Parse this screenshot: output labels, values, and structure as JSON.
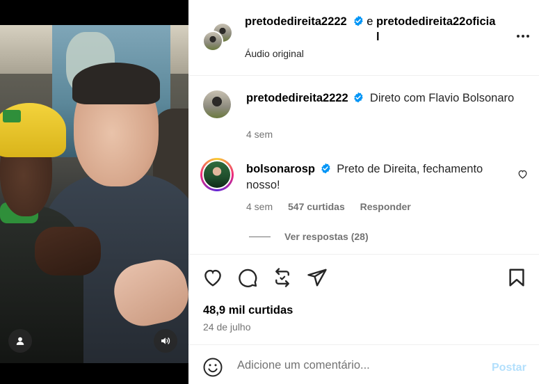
{
  "header": {
    "user1": "pretodedireita2222",
    "conjunction": "e",
    "user2": "pretodedireita22oficial",
    "audio": "Áudio original",
    "more_icon": "more-horizontal-icon"
  },
  "caption": {
    "username": "pretodedireita2222",
    "text": "Direto com Flavio Bolsonaro",
    "time": "4 sem"
  },
  "comment": {
    "username": "bolsonarosp",
    "text": "Preto de Direita, fechamento nosso!",
    "time": "4 sem",
    "likes": "547 curtidas",
    "reply": "Responder",
    "view_replies": "Ver respostas (28)"
  },
  "post": {
    "likes": "48,9 mil curtidas",
    "date": "24 de julho"
  },
  "add_comment": {
    "placeholder": "Adicione um comentário...",
    "post_label": "Postar"
  },
  "colors": {
    "verified": "#0095f6",
    "post_disabled": "#b2dffc",
    "secondary_text": "#737373"
  }
}
